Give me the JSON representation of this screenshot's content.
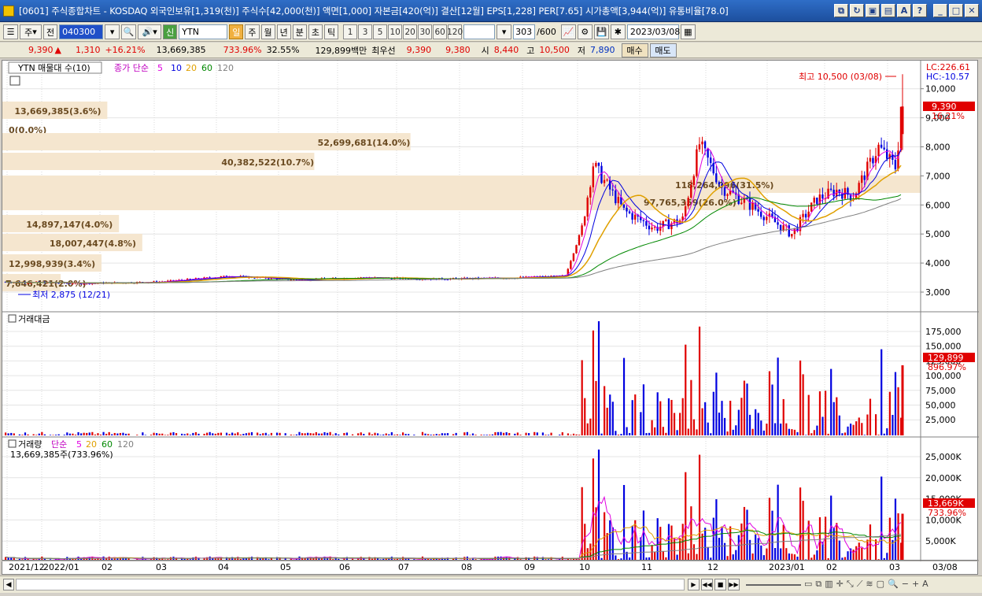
{
  "window": {
    "title": "[0601] 주식종합차트 - KOSDAQ 외국인보유[1,319(천)] 주식수[42,000(천)] 액면[1,000] 자본금[420(억)] 결산[12월] EPS[1,228] PER[7.65] 시가총액[3,944(억)] 유통비율[78.0]"
  },
  "toolbar": {
    "market_select": "주",
    "prev_button": "전",
    "stock_code": "040300",
    "stock_name": "YTN",
    "badge": "신",
    "periods": [
      "일",
      "주",
      "월",
      "년",
      "분",
      "초",
      "틱"
    ],
    "active_period": "일",
    "intervals": [
      "1",
      "3",
      "5",
      "10",
      "20",
      "30",
      "60",
      "120"
    ],
    "count": "303",
    "count_total": "/600",
    "date": "2023/03/08"
  },
  "quote": {
    "price": "9,390",
    "direction": "▲",
    "change": "1,310",
    "change_pct": "+16.21%",
    "volume": "13,669,385",
    "volume_ratio": "733.96%",
    "turnover": "32.55%",
    "amount": "129,899백만",
    "best_label": "최우선",
    "best_ask": "9,390",
    "best_bid": "9,380",
    "open_label": "시",
    "open": "8,440",
    "high_label": "고",
    "high": "10,500",
    "low_label": "저",
    "low": "7,890",
    "buy_button": "매수",
    "sell_button": "매도"
  },
  "price_pane": {
    "legend_name": "YTN 매물대 수(10)",
    "ma_label": "종가 단순",
    "ma_periods": [
      "5",
      "10",
      "20",
      "60",
      "120"
    ],
    "ma_colors": [
      "#e000e0",
      "#0000e0",
      "#e0a000",
      "#008800",
      "#808080"
    ],
    "lc": "LC:226.61",
    "hc": "HC:-10.57",
    "high_annotation": "최고 10,500 (03/08)",
    "low_annotation": "최저 2,875 (12/21)",
    "current_price_tag": "9,390",
    "current_pct_tag": "16.21%",
    "y_ticks": [
      "10,000",
      "9,000",
      "8,000",
      "7,000",
      "6,000",
      "5,000",
      "4,000",
      "3,000"
    ],
    "volume_profile": [
      {
        "label": "13,669,385(3.6%)",
        "fraction": 0.036
      },
      {
        "label": "0(0.0%)",
        "fraction": 0.0
      },
      {
        "label": "52,699,681(14.0%)",
        "fraction": 0.14
      },
      {
        "label": "40,382,522(10.7%)",
        "fraction": 0.107
      },
      {
        "label": "118,264,096(31.5%)",
        "fraction": 0.315
      },
      {
        "label": "97,765,359(26.0%)",
        "fraction": 0.26
      },
      {
        "label": "14,897,147(4.0%)",
        "fraction": 0.04
      },
      {
        "label": "18,007,447(4.8%)",
        "fraction": 0.048
      },
      {
        "label": "12,998,939(3.4%)",
        "fraction": 0.034
      },
      {
        "label": "7,646,421(2.0%)",
        "fraction": 0.02
      }
    ]
  },
  "amount_pane": {
    "title": "거래대금",
    "y_ticks": [
      "175,000",
      "150,000",
      "125,000",
      "100,000",
      "75,000",
      "50,000",
      "25,000"
    ],
    "current_tag": "129,899",
    "current_pct": "896.97%"
  },
  "volume_pane": {
    "title": "거래량",
    "ma_label": "단순",
    "ma_periods": [
      "5",
      "20",
      "60",
      "120"
    ],
    "sub_label": "13,669,385주(733.96%)",
    "y_ticks": [
      "25,000K",
      "20,000K",
      "15,000K",
      "10,000K",
      "5,000K"
    ],
    "current_tag": "13,669K",
    "current_pct": "733.96%"
  },
  "x_axis": {
    "labels": [
      "2021/12",
      "2022/01",
      "02",
      "03",
      "04",
      "05",
      "06",
      "07",
      "08",
      "09",
      "10",
      "11",
      "12",
      "2023/01",
      "02",
      "03"
    ],
    "right_label": "03/08"
  },
  "colors": {
    "up": "#e00000",
    "down": "#0000e0",
    "profile": "#f5e6cf",
    "titlebar": "#2f6ec7"
  },
  "chart_data": {
    "type": "candlestick",
    "daily": [
      {
        "date": "2022/01/14",
        "close": 3350
      },
      {
        "date": "2022/02/15",
        "close": 3300
      },
      {
        "date": "2022/03/15",
        "close": 3350
      },
      {
        "date": "2022/04/15",
        "close": 3550
      },
      {
        "date": "2022/05/16",
        "close": 3420
      },
      {
        "date": "2022/06/15",
        "close": 3500
      },
      {
        "date": "2022/07/15",
        "close": 3450
      },
      {
        "date": "2022/08/16",
        "close": 3480
      },
      {
        "date": "2022/09/15",
        "close": 3550
      },
      {
        "date": "2022/09/20",
        "close": 5200
      },
      {
        "date": "2022/09/23",
        "close": 7400
      },
      {
        "date": "2022/10/04",
        "close": 5800
      },
      {
        "date": "2022/10/17",
        "close": 5200
      },
      {
        "date": "2022/10/31",
        "close": 5500
      },
      {
        "date": "2022/11/04",
        "close": 8100
      },
      {
        "date": "2022/11/15",
        "close": 6600
      },
      {
        "date": "2022/11/30",
        "close": 6000
      },
      {
        "date": "2022/12/21",
        "close": 5000
      },
      {
        "date": "2023/01/10",
        "close": 6200
      },
      {
        "date": "2023/01/31",
        "close": 6500
      },
      {
        "date": "2023/02/14",
        "close": 6300
      },
      {
        "date": "2023/02/27",
        "close": 8000
      },
      {
        "date": "2023/03/06",
        "close": 7300
      },
      {
        "date": "2023/03/07",
        "close": 8080
      },
      {
        "date": "2023/03/08",
        "open": 8440,
        "high": 10500,
        "low": 7890,
        "close": 9390
      }
    ],
    "volume_latest": 13669385,
    "amount_latest_million": 129899
  }
}
